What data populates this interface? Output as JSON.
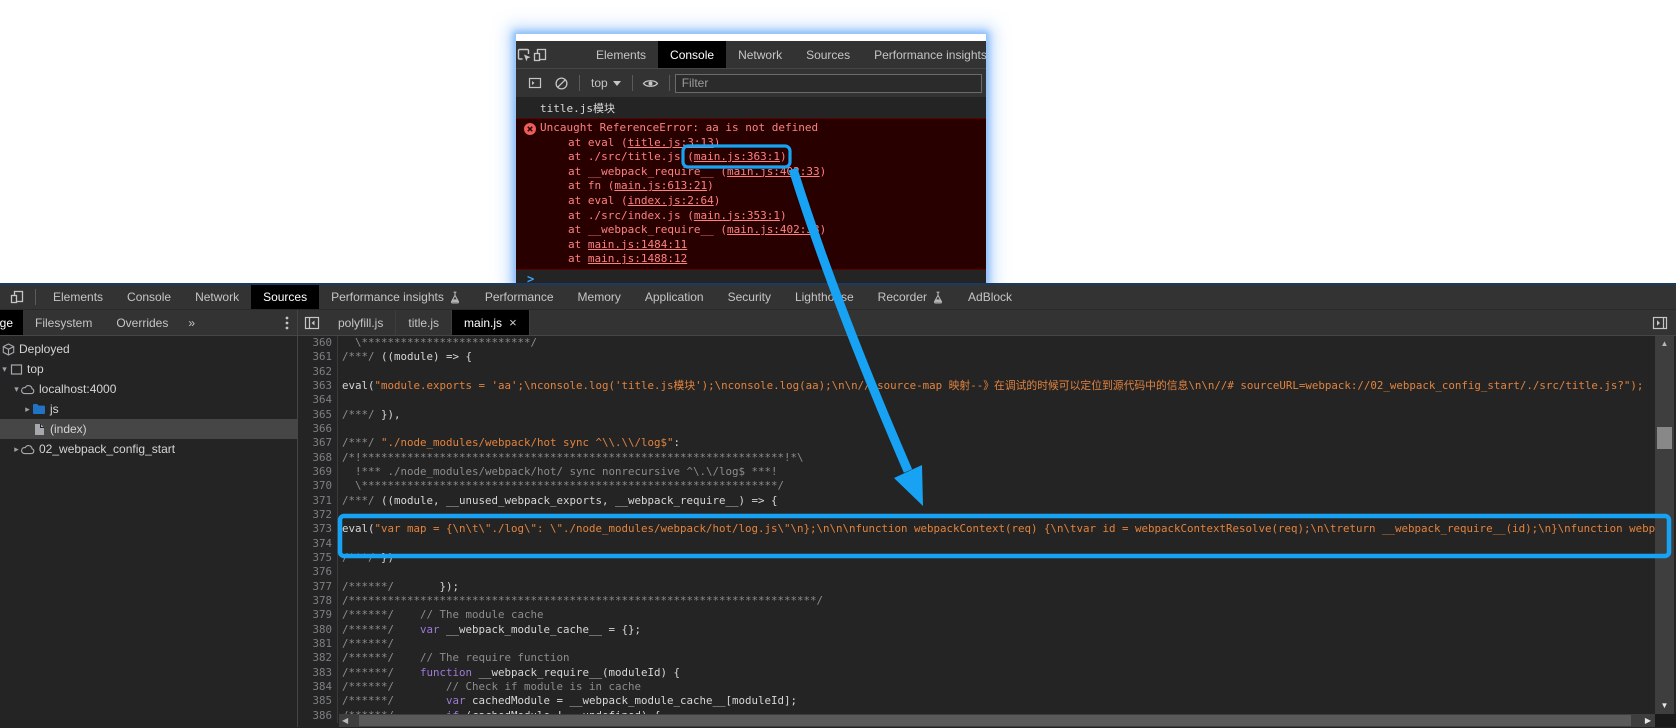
{
  "annotation": {
    "color": "#17a2f3"
  },
  "console_window": {
    "tabs": [
      {
        "label": "Elements"
      },
      {
        "label": "Console",
        "selected": true
      },
      {
        "label": "Network"
      },
      {
        "label": "Sources"
      },
      {
        "label": "Performance insights",
        "beaker": true
      }
    ],
    "toolbar": {
      "context_label": "top",
      "filter_placeholder": "Filter"
    },
    "log_message": "title.js模块",
    "error": {
      "message": "Uncaught ReferenceError: aa is not defined",
      "stack": [
        {
          "prefix": "at eval (",
          "link": "title.js:3:13",
          "suffix": ")"
        },
        {
          "prefix": "at ./src/title.js (",
          "link": "main.js:363:1",
          "suffix": ")",
          "annotated": true
        },
        {
          "prefix": "at __webpack_require__ (",
          "link": "main.js:402:33",
          "suffix": ")"
        },
        {
          "prefix": "at fn (",
          "link": "main.js:613:21",
          "suffix": ")"
        },
        {
          "prefix": "at eval (",
          "link": "index.js:2:64",
          "suffix": ")"
        },
        {
          "prefix": "at ./src/index.js (",
          "link": "main.js:353:1",
          "suffix": ")"
        },
        {
          "prefix": "at __webpack_require__ (",
          "link": "main.js:402:33",
          "suffix": ")"
        },
        {
          "prefix": "at ",
          "link": "main.js:1484:11",
          "suffix": ""
        },
        {
          "prefix": "at ",
          "link": "main.js:1488:12",
          "suffix": ""
        }
      ]
    },
    "prompt": ">"
  },
  "devtools": {
    "main_tabs": [
      {
        "label": "Elements"
      },
      {
        "label": "Console"
      },
      {
        "label": "Network"
      },
      {
        "label": "Sources",
        "selected": true
      },
      {
        "label": "Performance insights",
        "beaker": true
      },
      {
        "label": "Performance"
      },
      {
        "label": "Memory"
      },
      {
        "label": "Application"
      },
      {
        "label": "Security"
      },
      {
        "label": "Lighthouse"
      },
      {
        "label": "Recorder",
        "beaker": true
      },
      {
        "label": "AdBlock"
      }
    ],
    "sidebar_tabs": {
      "page": "Page",
      "others": [
        "Filesystem",
        "Overrides"
      ],
      "more": "»"
    },
    "file_tabs": [
      {
        "label": "polyfill.js"
      },
      {
        "label": "title.js"
      },
      {
        "label": "main.js",
        "selected": true,
        "close": "×"
      }
    ],
    "tree": [
      {
        "label": "Deployed",
        "icon": "cube",
        "arrow": "",
        "pl": 1
      },
      {
        "label": "top",
        "icon": "frame",
        "arrow": "down",
        "pl": 0
      },
      {
        "label": "localhost:4000",
        "icon": "cloud",
        "arrow": "down",
        "pl": 12
      },
      {
        "label": "js",
        "icon": "folder",
        "arrow": "right",
        "pl": 23
      },
      {
        "label": "(index)",
        "icon": "file",
        "arrow": "none",
        "pl": 23,
        "selected": true
      },
      {
        "label": "02_webpack_config_start",
        "icon": "cloud",
        "arrow": "right",
        "pl": 12
      }
    ],
    "code_lines": [
      {
        "n": 360,
        "segs": [
          [
            "c",
            "  \\**************************/"
          ]
        ]
      },
      {
        "n": 361,
        "segs": [
          [
            "c",
            "/***/"
          ],
          [
            "d",
            " ((module) => {"
          ]
        ]
      },
      {
        "n": 362,
        "segs": []
      },
      {
        "n": 363,
        "segs": [
          [
            "d",
            "eval("
          ],
          [
            "s",
            "\"module.exports = 'aa';\\nconsole.log('title.js模块');\\nconsole.log(aa);\\n\\n// source-map 映射--》在调试的时候可以定位到源代码中的信息\\n\\n//# sourceURL=webpack://02_webpack_config_start/./src/title.js?\");"
          ]
        ]
      },
      {
        "n": 364,
        "segs": []
      },
      {
        "n": 365,
        "segs": [
          [
            "c",
            "/***/"
          ],
          [
            "d",
            " }),"
          ]
        ]
      },
      {
        "n": 366,
        "segs": []
      },
      {
        "n": 367,
        "segs": [
          [
            "c",
            "/***/ "
          ],
          [
            "s",
            "\"./node_modules/webpack/hot sync ^\\\\.\\\\/log$\""
          ],
          [
            "d",
            ":"
          ]
        ]
      },
      {
        "n": 368,
        "segs": [
          [
            "c",
            "/*!*****************************************************************!*\\"
          ]
        ]
      },
      {
        "n": 369,
        "segs": [
          [
            "c",
            "  !*** ./node_modules/webpack/hot/ sync nonrecursive ^\\.\\/log$ ***!"
          ]
        ]
      },
      {
        "n": 370,
        "segs": [
          [
            "c",
            "  \\****************************************************************/"
          ]
        ]
      },
      {
        "n": 371,
        "segs": [
          [
            "c",
            "/***/"
          ],
          [
            "d",
            " ((module, __unused_webpack_exports, __webpack_require__) => {"
          ]
        ]
      },
      {
        "n": 372,
        "segs": []
      },
      {
        "n": 373,
        "segs": [
          [
            "d",
            "eval("
          ],
          [
            "s",
            "\"var map = {\\n\\t\\\"./log\\\": \\\"./node_modules/webpack/hot/log.js\\\"\\n};\\n\\n\\nfunction webpackContext(req) {\\n\\tvar id = webpackContextResolve(req);\\n\\treturn __webpack_require__(id);\\n}\\nfunction webpackContextResolve(req) {\\n\\tif(!__webpack_require__.o(map, req)) {\""
          ]
        ]
      },
      {
        "n": 374,
        "segs": []
      },
      {
        "n": 375,
        "segs": [
          [
            "c",
            "/***/"
          ],
          [
            "d",
            " })"
          ]
        ]
      },
      {
        "n": 376,
        "segs": []
      },
      {
        "n": 377,
        "segs": [
          [
            "c",
            "/******/"
          ],
          [
            "d",
            "       });"
          ]
        ]
      },
      {
        "n": 378,
        "segs": [
          [
            "c",
            "/************************************************************************/"
          ]
        ]
      },
      {
        "n": 379,
        "segs": [
          [
            "c",
            "/******/    // The module cache"
          ]
        ]
      },
      {
        "n": 380,
        "segs": [
          [
            "c",
            "/******/"
          ],
          [
            "d",
            "    "
          ],
          [
            "k",
            "var"
          ],
          [
            "d",
            " __webpack_module_cache__ = {};"
          ]
        ]
      },
      {
        "n": 381,
        "segs": [
          [
            "c",
            "/******/"
          ]
        ]
      },
      {
        "n": 382,
        "segs": [
          [
            "c",
            "/******/    // The require function"
          ]
        ]
      },
      {
        "n": 383,
        "segs": [
          [
            "c",
            "/******/"
          ],
          [
            "d",
            "    "
          ],
          [
            "k",
            "function"
          ],
          [
            "d",
            " __webpack_require__(moduleId) {"
          ]
        ]
      },
      {
        "n": 384,
        "segs": [
          [
            "c",
            "/******/        // Check if module is in cache"
          ]
        ]
      },
      {
        "n": 385,
        "segs": [
          [
            "c",
            "/******/"
          ],
          [
            "d",
            "        "
          ],
          [
            "k",
            "var"
          ],
          [
            "d",
            " cachedModule = __webpack_module_cache__[moduleId];"
          ]
        ]
      },
      {
        "n": 386,
        "segs": [
          [
            "c",
            "/******/"
          ],
          [
            "d",
            "        "
          ],
          [
            "k",
            "if"
          ],
          [
            "d",
            " (cachedModule !== undefined) {"
          ]
        ]
      }
    ]
  }
}
